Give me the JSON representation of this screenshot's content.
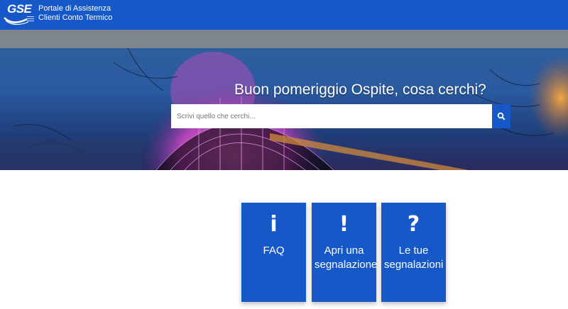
{
  "header": {
    "logo_text": "GSE",
    "title_line1": "Portale di Assistenza",
    "title_line2": "Clienti Conto Termico",
    "bar_color": "#1658c8"
  },
  "hero": {
    "greeting": "Buon pomeriggio Ospite, cosa cerchi?",
    "search_placeholder": "Scrivi quello che cerchi...",
    "search_icon": "search-icon"
  },
  "tiles": [
    {
      "icon": "info-icon",
      "glyph": "i",
      "label": "FAQ"
    },
    {
      "icon": "exclamation-icon",
      "glyph": "!",
      "label": "Apri una segnalazione"
    },
    {
      "icon": "question-icon",
      "glyph": "?",
      "label": "Le tue segnalazioni"
    }
  ]
}
